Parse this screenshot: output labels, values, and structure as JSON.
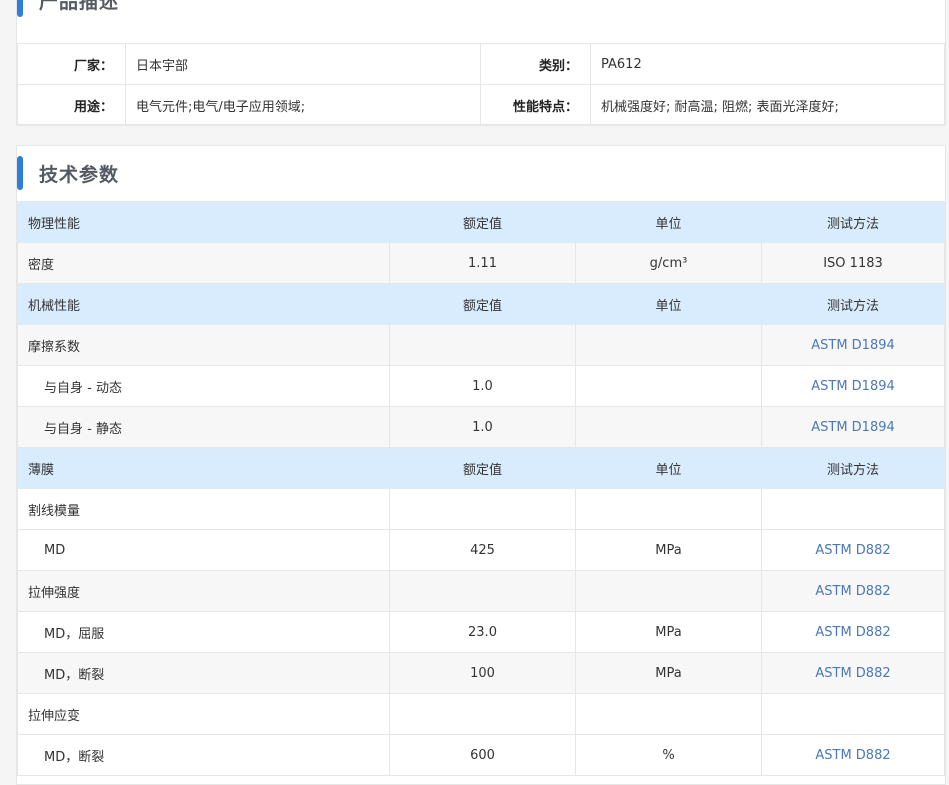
{
  "product_description": {
    "title": "产品描述",
    "rows": [
      {
        "k1": "厂家：",
        "v1": "日本宇部",
        "k2": "类别：",
        "v2": "PA612"
      },
      {
        "k1": "用途：",
        "v1": "电气元件;电气/电子应用领域;",
        "k2": "性能特点：",
        "v2": "机械强度好; 耐高温; 阻燃; 表面光泽度好;"
      }
    ]
  },
  "technical_parameters": {
    "title": "技术参数",
    "rows": [
      {
        "type": "header",
        "name": "物理性能",
        "value": "额定值",
        "unit": "单位",
        "method": "测试方法"
      },
      {
        "type": "data",
        "alt": true,
        "name": "密度",
        "value": "1.11",
        "unit": "g/cm³",
        "method": "ISO 1183",
        "link": false
      },
      {
        "type": "header",
        "name": "机械性能",
        "value": "额定值",
        "unit": "单位",
        "method": "测试方法"
      },
      {
        "type": "data",
        "alt": true,
        "name": "摩擦系数",
        "value": "",
        "unit": "",
        "method": "ASTM D1894",
        "link": true
      },
      {
        "type": "data",
        "sub": true,
        "name": "与自身 - 动态",
        "value": "1.0",
        "unit": "",
        "method": "ASTM D1894",
        "link": true
      },
      {
        "type": "data",
        "alt": true,
        "sub": true,
        "name": "与自身 - 静态",
        "value": "1.0",
        "unit": "",
        "method": "ASTM D1894",
        "link": true
      },
      {
        "type": "header",
        "name": "薄膜",
        "value": "额定值",
        "unit": "单位",
        "method": "测试方法"
      },
      {
        "type": "data",
        "name": "割线模量",
        "value": "",
        "unit": "",
        "method": "",
        "link": false
      },
      {
        "type": "data",
        "sub": true,
        "name": "MD",
        "value": "425",
        "unit": "MPa",
        "method": "ASTM D882",
        "link": true
      },
      {
        "type": "data",
        "alt": true,
        "name": "拉伸强度",
        "value": "",
        "unit": "",
        "method": "ASTM D882",
        "link": true
      },
      {
        "type": "data",
        "sub": true,
        "name": "MD，屈服",
        "value": "23.0",
        "unit": "MPa",
        "method": "ASTM D882",
        "link": true
      },
      {
        "type": "data",
        "alt": true,
        "sub": true,
        "name": "MD，断裂",
        "value": "100",
        "unit": "MPa",
        "method": "ASTM D882",
        "link": true
      },
      {
        "type": "data",
        "name": "拉伸应变",
        "value": "",
        "unit": "",
        "method": "",
        "link": false
      },
      {
        "type": "data",
        "sub": true,
        "name": "MD，断裂",
        "value": "600",
        "unit": "%",
        "method": "ASTM D882",
        "link": true
      }
    ]
  }
}
